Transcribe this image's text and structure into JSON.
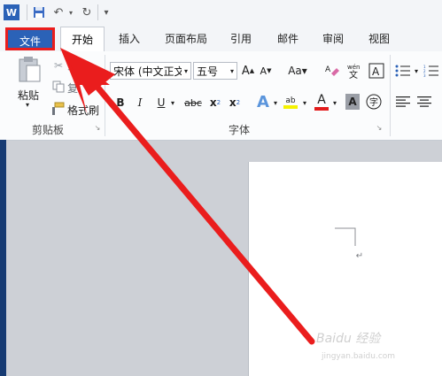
{
  "tabs": {
    "file": "文件",
    "home": "开始",
    "insert": "插入",
    "layout": "页面布局",
    "references": "引用",
    "mailings": "邮件",
    "review": "审阅",
    "view": "视图"
  },
  "clipboard": {
    "paste": "粘贴",
    "cut": "剪切",
    "copy": "复",
    "format_painter": "格式刷",
    "group_label": "剪贴板"
  },
  "font": {
    "name": "宋体 (中文正文",
    "size": "五号",
    "group_label": "字体",
    "bold": "B",
    "italic": "I",
    "underline": "U",
    "strike": "abc",
    "highlight_text": "ab"
  },
  "colors": {
    "accent": "#2b62b7",
    "annotation": "#ea1d1d"
  },
  "watermark": "Baidu 经验 jingyan.baidu.com"
}
